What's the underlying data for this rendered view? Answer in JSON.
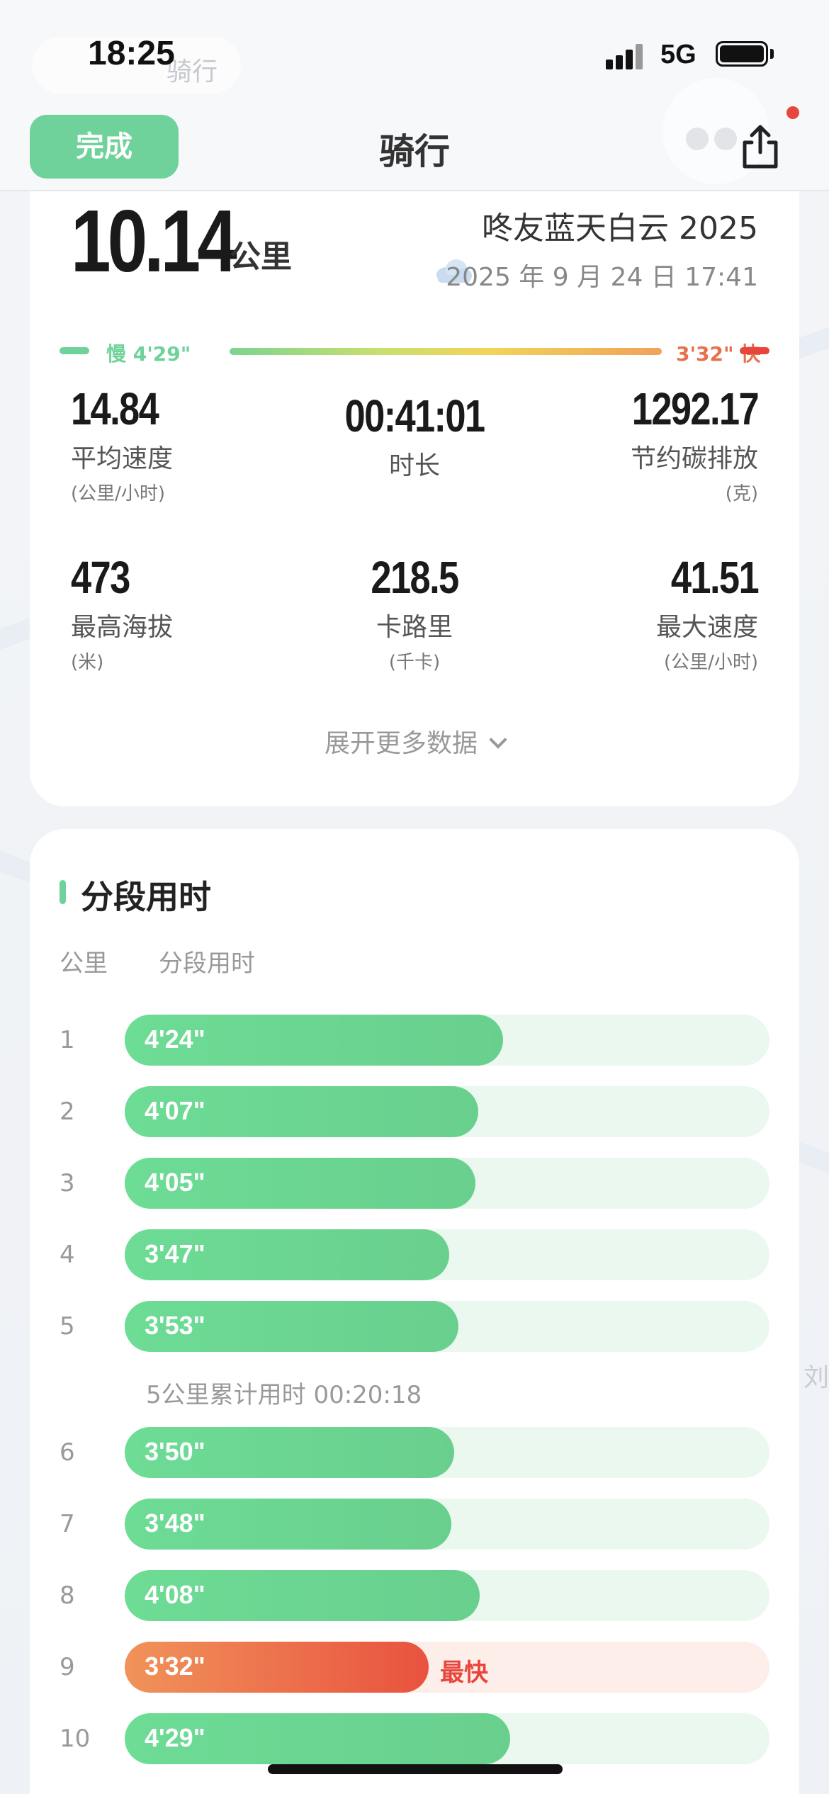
{
  "status_bar": {
    "time": "18:25",
    "network": "5G"
  },
  "header": {
    "ghost_chip_text": "骑行",
    "done_label": "完成",
    "title": "骑行"
  },
  "summary": {
    "distance": "10.14",
    "distance_unit": "公里",
    "title": "咚友蓝天白云 2025",
    "datetime": "2025 年 9 月 24 日 17:41",
    "pace_slow": "慢 4'29\"",
    "pace_fast": "3'32\" 快",
    "stats": [
      {
        "value": "14.84",
        "label": "平均速度",
        "unit": "(公里/小时)"
      },
      {
        "value": "00:41:01",
        "label": "时长",
        "unit": ""
      },
      {
        "value": "1292.17",
        "label": "节约碳排放",
        "unit": "(克)"
      },
      {
        "value": "473",
        "label": "最高海拔",
        "unit": "(米)"
      },
      {
        "value": "218.5",
        "label": "卡路里",
        "unit": "(千卡)"
      },
      {
        "value": "41.51",
        "label": "最大速度",
        "unit": "(公里/小时)"
      }
    ],
    "expand_label": "展开更多数据"
  },
  "splits": {
    "title": "分段用时",
    "col_km": "公里",
    "col_time": "分段用时",
    "rows": [
      {
        "km": "1",
        "time": "4'24\"",
        "fraction": 0.587
      },
      {
        "km": "2",
        "time": "4'07\"",
        "fraction": 0.548
      },
      {
        "km": "3",
        "time": "4'05\"",
        "fraction": 0.544
      },
      {
        "km": "4",
        "time": "3'47\"",
        "fraction": 0.503
      },
      {
        "km": "5",
        "time": "3'53\"",
        "fraction": 0.518
      },
      {
        "km": "6",
        "time": "3'50\"",
        "fraction": 0.511
      },
      {
        "km": "7",
        "time": "3'48\"",
        "fraction": 0.507
      },
      {
        "km": "8",
        "time": "4'08\"",
        "fraction": 0.55
      },
      {
        "km": "9",
        "time": "3'32\"",
        "fraction": 0.471,
        "fastest": true,
        "badge": "最快"
      },
      {
        "km": "10",
        "time": "4'29\"",
        "fraction": 0.598
      }
    ],
    "cumulative_5km": "5公里累计用时 00:20:18"
  },
  "map_label": "刘",
  "colors": {
    "accent": "#6fd29a",
    "fast": "#e8453c"
  }
}
